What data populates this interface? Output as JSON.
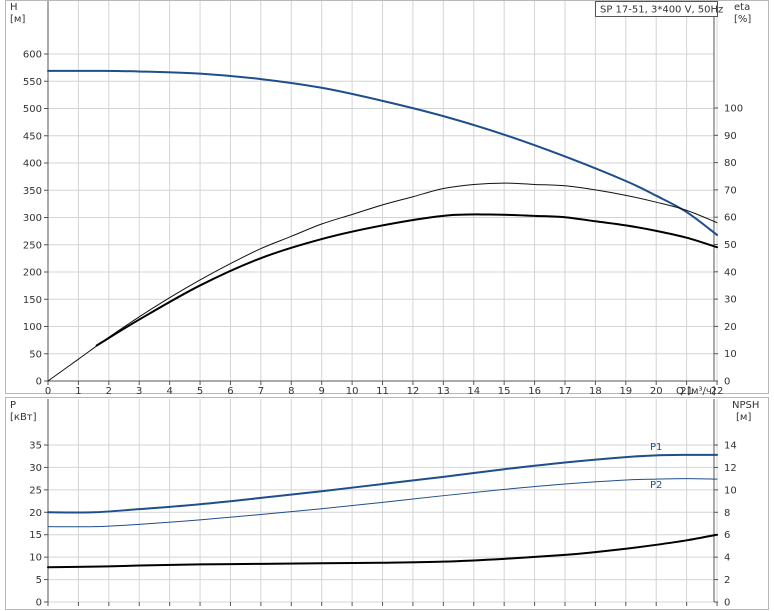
{
  "chart_data": [
    {
      "type": "line",
      "title": "SP 17-51, 3*400 V, 50Hz",
      "xlabel": "Q [м³/ч]",
      "ylabel_left": "H",
      "ylabel_left_unit": "[м]",
      "ylabel_right": "eta",
      "ylabel_right_unit": "[%]",
      "xlim": [
        0,
        22
      ],
      "ylim_left": [
        0,
        600
      ],
      "ylim_right": [
        0,
        120
      ],
      "x_ticks": [
        "0",
        "1",
        "2",
        "3",
        "4",
        "5",
        "6",
        "7",
        "8",
        "9",
        "10",
        "11",
        "12",
        "13",
        "14",
        "15",
        "16",
        "17",
        "18",
        "19",
        "20",
        "21",
        "22"
      ],
      "y_left_ticks": [
        "0",
        "50",
        "100",
        "150",
        "200",
        "250",
        "300",
        "350",
        "400",
        "450",
        "500",
        "550",
        "600"
      ],
      "y_right_ticks": [
        "0",
        "10",
        "20",
        "30",
        "40",
        "50",
        "60",
        "70",
        "80",
        "90",
        "100"
      ],
      "grid": true,
      "series": [
        {
          "axis": "left",
          "color": "#1f4e8c",
          "x": [
            0,
            1.6,
            3,
            5,
            7,
            9,
            11,
            13,
            15,
            17,
            19,
            20,
            21,
            22
          ],
          "y": [
            569,
            569,
            568,
            564,
            554,
            538,
            514,
            486,
            452,
            412,
            367,
            340,
            310,
            268
          ]
        },
        {
          "axis": "right",
          "color": "#111111",
          "x": [
            0,
            1,
            2,
            3,
            4,
            5,
            6,
            7,
            8,
            9,
            10,
            11,
            12,
            13,
            14,
            15,
            16,
            17,
            18,
            19,
            20,
            21,
            22
          ],
          "y": [
            0,
            8,
            16,
            23.5,
            30.5,
            37,
            43,
            48.5,
            53,
            57.5,
            61,
            64.5,
            67.5,
            70.5,
            72,
            72.5,
            72,
            71.5,
            70,
            68,
            65.5,
            62.5,
            58
          ]
        },
        {
          "axis": "right",
          "color": "#000000",
          "x": [
            1.6,
            3,
            5,
            7,
            9,
            11,
            13,
            14.5,
            16,
            17,
            18,
            19,
            20,
            21,
            22
          ],
          "y": [
            13,
            22.5,
            35,
            45,
            52,
            57,
            60.5,
            61,
            60.5,
            60,
            58.5,
            57,
            55,
            52.5,
            49
          ]
        }
      ]
    },
    {
      "type": "line",
      "xlabel": "",
      "ylabel_left": "P",
      "ylabel_left_unit": "[кВт]",
      "ylabel_right": "NPSH",
      "ylabel_right_unit": "[м]",
      "xlim": [
        0,
        22
      ],
      "ylim_left": [
        0,
        40
      ],
      "ylim_right": [
        0,
        16
      ],
      "y_left_ticks": [
        "0",
        "5",
        "10",
        "15",
        "20",
        "25",
        "30",
        "35"
      ],
      "y_right_ticks": [
        "0",
        "2",
        "4",
        "6",
        "8",
        "10",
        "12",
        "14"
      ],
      "grid": true,
      "series": [
        {
          "name": "P1",
          "axis": "left",
          "color": "#1f4e8c",
          "x": [
            0,
            1.5,
            3,
            5,
            7,
            9,
            11,
            13,
            15,
            17,
            19,
            20,
            21,
            22
          ],
          "y": [
            20,
            20,
            20.7,
            21.8,
            23.2,
            24.7,
            26.3,
            27.9,
            29.6,
            31.1,
            32.3,
            32.7,
            32.8,
            32.8
          ]
        },
        {
          "name": "P2",
          "axis": "left",
          "color": "#1f4e8c",
          "x": [
            0,
            1.5,
            3,
            5,
            7,
            9,
            11,
            13,
            15,
            17,
            19,
            20,
            21,
            22
          ],
          "y": [
            16.8,
            16.8,
            17.3,
            18.3,
            19.5,
            20.8,
            22.2,
            23.7,
            25.1,
            26.3,
            27.2,
            27.4,
            27.5,
            27.4
          ]
        },
        {
          "axis": "right",
          "color": "#000000",
          "x": [
            0,
            1.5,
            3,
            5,
            7,
            9,
            11,
            13,
            15,
            17,
            18,
            19,
            20,
            21,
            22
          ],
          "y": [
            3.1,
            3.15,
            3.25,
            3.35,
            3.4,
            3.45,
            3.5,
            3.6,
            3.85,
            4.2,
            4.45,
            4.75,
            5.1,
            5.5,
            6.0
          ]
        }
      ]
    }
  ]
}
